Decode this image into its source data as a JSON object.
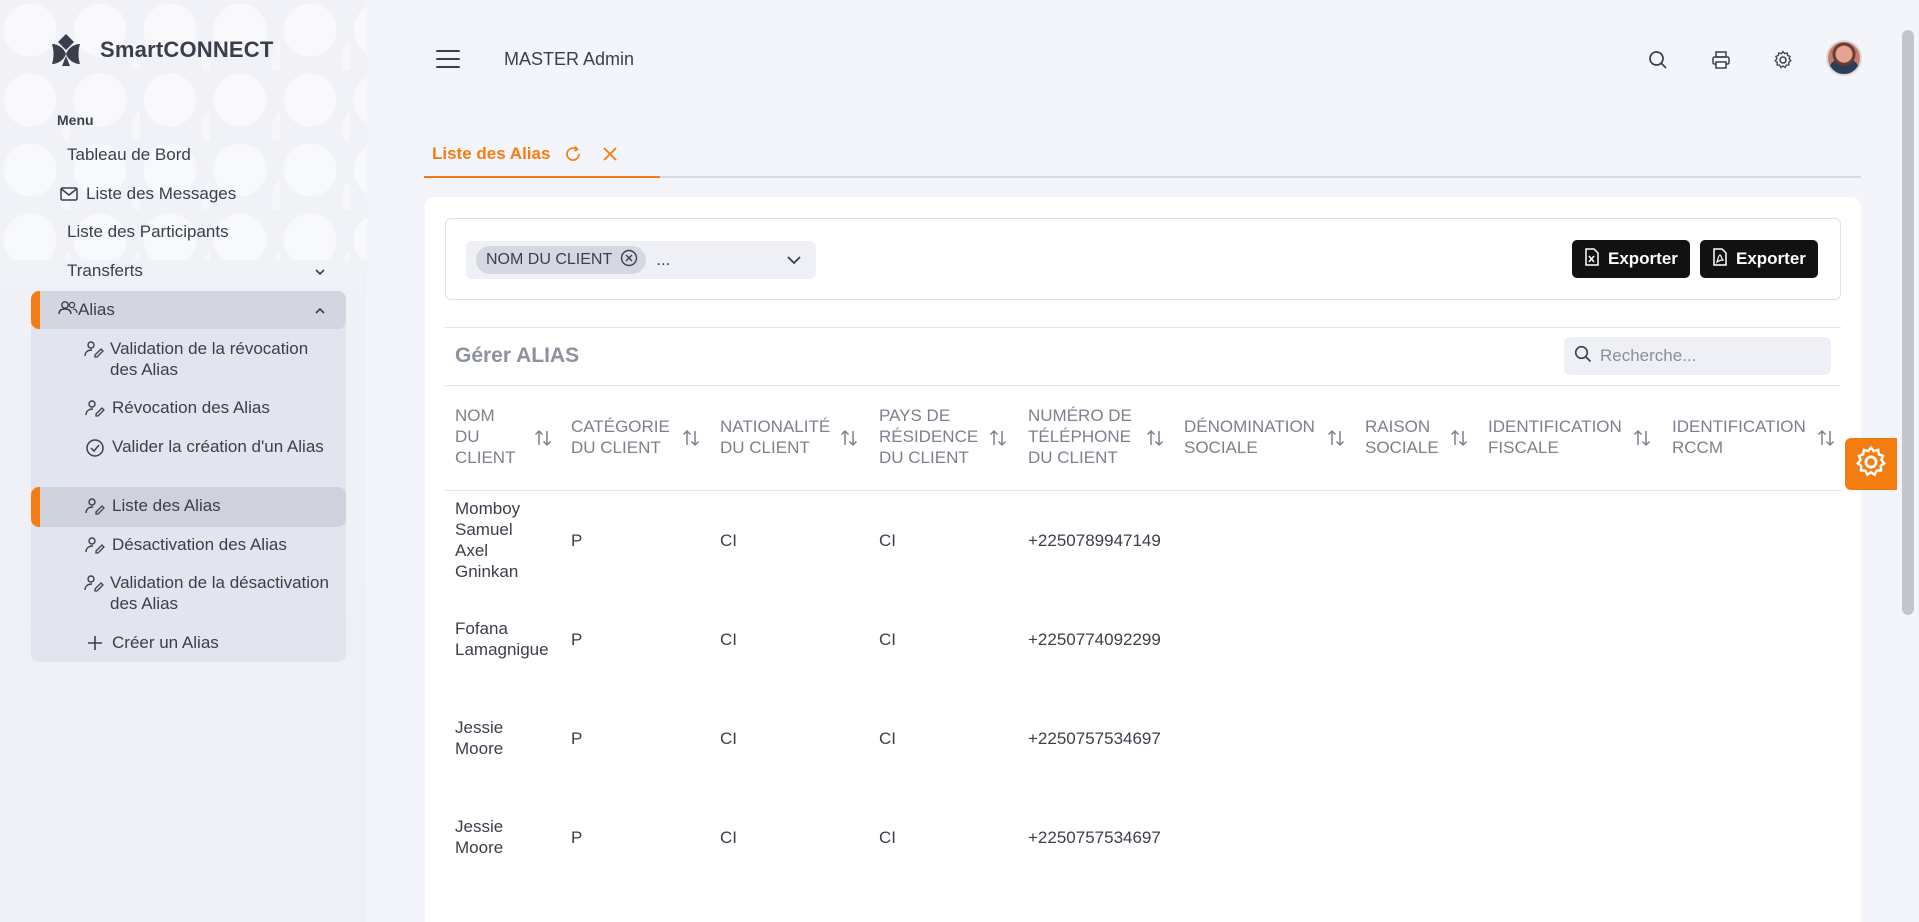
{
  "app": {
    "brand": "SmartCONNECT",
    "accent": "#f47d12"
  },
  "sidebar": {
    "menu_title": "Menu",
    "items": [
      {
        "label": "Tableau de Bord",
        "icon": "none"
      },
      {
        "label": "Liste des Messages",
        "icon": "mail-icon"
      },
      {
        "label": "Liste des Participants",
        "icon": "none"
      },
      {
        "label": "Transferts",
        "icon": "none",
        "expand": "chevron-down-icon"
      },
      {
        "label": "Alias",
        "icon": "users-icon",
        "expand": "chevron-up-icon",
        "expanded": true
      }
    ],
    "alias_sub": [
      {
        "label": "Validation de la révocation des Alias",
        "icon": "user-edit-icon"
      },
      {
        "label": "Révocation des Alias",
        "icon": "user-edit-icon"
      },
      {
        "label": "Valider la création d'un Alias",
        "icon": "check-circle-icon"
      },
      {
        "label": "Liste des Alias",
        "icon": "user-edit-icon",
        "active": true
      },
      {
        "label": "Désactivation des Alias",
        "icon": "user-edit-icon"
      },
      {
        "label": "Validation de la désactivation des Alias",
        "icon": "user-edit-icon"
      },
      {
        "label": "Créer un Alias",
        "icon": "plus-icon"
      }
    ]
  },
  "header": {
    "breadcrumb": "MASTER Admin",
    "icons": [
      "search-icon",
      "printer-icon",
      "gear-icon",
      "avatar"
    ]
  },
  "tabs": [
    {
      "label": "Liste des Alias",
      "active": true
    }
  ],
  "filter": {
    "chip": "NOM DU CLIENT",
    "more": "...",
    "export_excel_label": "Exporter",
    "export_pdf_label": "Exporter"
  },
  "section": {
    "title": "Gérer ALIAS",
    "search_placeholder": "Recherche..."
  },
  "table": {
    "columns": [
      [
        "NOM",
        "DU",
        "CLIENT"
      ],
      [
        "CATÉGORIE",
        "DU CLIENT"
      ],
      [
        "NATIONALITÉ",
        "DU CLIENT"
      ],
      [
        "PAYS DE",
        "RÉSIDENCE",
        "DU CLIENT"
      ],
      [
        "NUMÉRO DE",
        "TÉLÉPHONE",
        "DU CLIENT"
      ],
      [
        "DÉNOMINATION",
        "SOCIALE"
      ],
      [
        "RAISON",
        "SOCIALE"
      ],
      [
        "IDENTIFICATION",
        "FISCALE"
      ],
      [
        "IDENTIFICATION",
        "RCCM"
      ]
    ],
    "rows": [
      {
        "nom": [
          "Momboy",
          "Samuel",
          "Axel",
          "Gninkan"
        ],
        "categorie": "P",
        "nationalite": "CI",
        "pays": "CI",
        "telephone": "+2250789947149"
      },
      {
        "nom": [
          "Fofana",
          "Lamagnigue"
        ],
        "categorie": "P",
        "nationalite": "CI",
        "pays": "CI",
        "telephone": "+2250774092299"
      },
      {
        "nom": [
          "Jessie",
          "Moore"
        ],
        "categorie": "P",
        "nationalite": "CI",
        "pays": "CI",
        "telephone": "+2250757534697"
      },
      {
        "nom": [
          "Jessie",
          "Moore"
        ],
        "categorie": "P",
        "nationalite": "CI",
        "pays": "CI",
        "telephone": "+2250757534697"
      }
    ]
  }
}
